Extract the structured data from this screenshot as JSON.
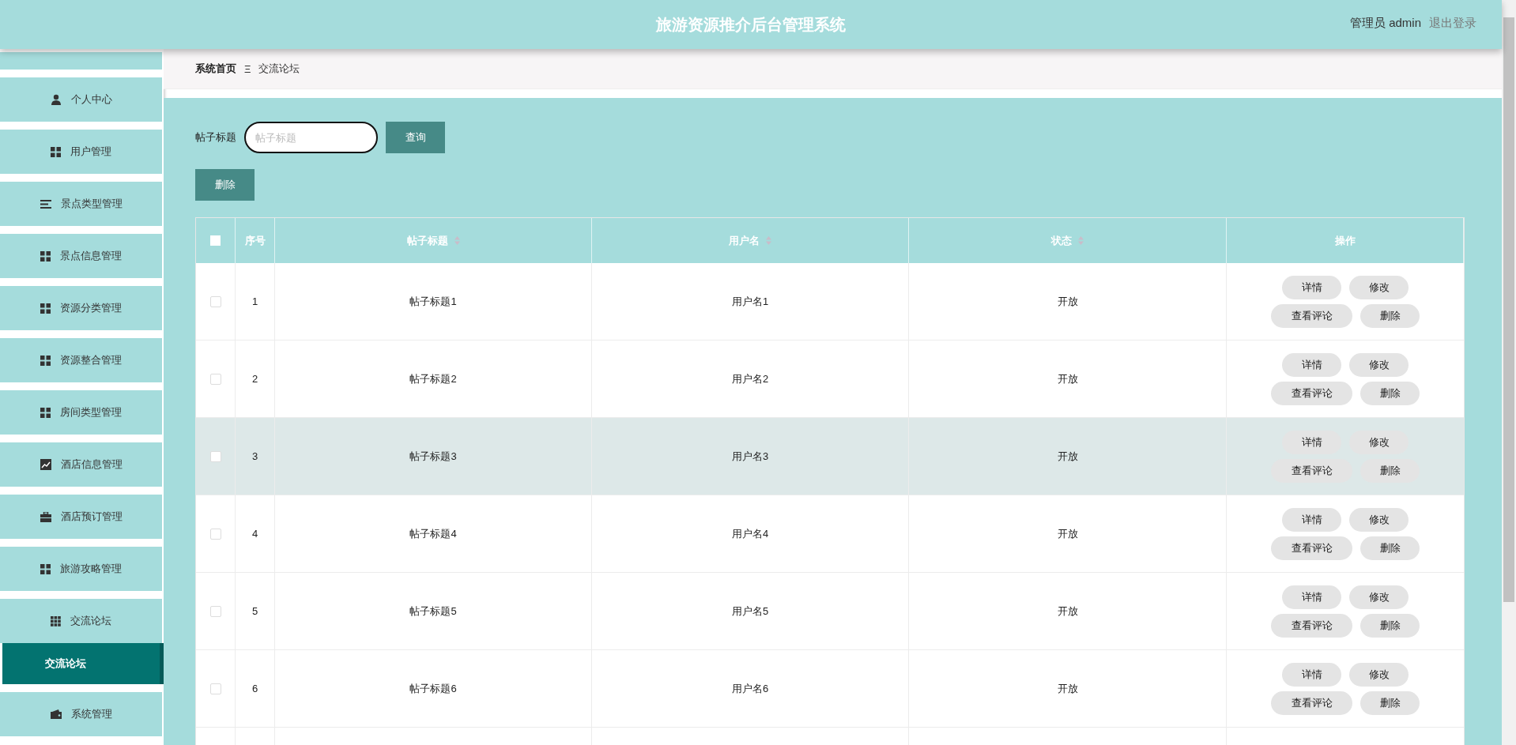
{
  "header": {
    "title": "旅游资源推介后台管理系统",
    "user": "管理员 admin",
    "logout": "退出登录"
  },
  "sidebar": {
    "items": [
      {
        "label": "个人中心"
      },
      {
        "label": "用户管理"
      },
      {
        "label": "景点类型管理"
      },
      {
        "label": "景点信息管理"
      },
      {
        "label": "资源分类管理"
      },
      {
        "label": "资源整合管理"
      },
      {
        "label": "房间类型管理"
      },
      {
        "label": "酒店信息管理"
      },
      {
        "label": "酒店预订管理"
      },
      {
        "label": "旅游攻略管理"
      },
      {
        "label": "交流论坛",
        "children": [
          {
            "label": "交流论坛",
            "selected": true
          }
        ]
      },
      {
        "label": "系统管理"
      }
    ]
  },
  "breadcrumb": {
    "home": "系统首页",
    "separator": "Ξ",
    "current": "交流论坛"
  },
  "search": {
    "label": "帖子标题",
    "placeholder": "帖子标题",
    "button": "查询"
  },
  "delete_button": "删除",
  "table": {
    "select_all_checked": false,
    "columns": [
      {
        "label": "序号",
        "sortable": false
      },
      {
        "label": "帖子标题",
        "sortable": true
      },
      {
        "label": "用户名",
        "sortable": true
      },
      {
        "label": "状态",
        "sortable": true
      },
      {
        "label": "操作",
        "sortable": false
      }
    ],
    "rows": [
      {
        "index": "1",
        "title": "帖子标题1",
        "user": "用户名1",
        "status": "开放",
        "highlighted": false,
        "checked": false,
        "actions": [
          "详情",
          "修改",
          "查看评论",
          "删除"
        ]
      },
      {
        "index": "2",
        "title": "帖子标题2",
        "user": "用户名2",
        "status": "开放",
        "highlighted": false,
        "checked": false,
        "actions": [
          "详情",
          "修改",
          "查看评论",
          "删除"
        ]
      },
      {
        "index": "3",
        "title": "帖子标题3",
        "user": "用户名3",
        "status": "开放",
        "highlighted": true,
        "checked": false,
        "actions": [
          "详情",
          "修改",
          "查看评论",
          "删除"
        ]
      },
      {
        "index": "4",
        "title": "帖子标题4",
        "user": "用户名4",
        "status": "开放",
        "highlighted": false,
        "checked": false,
        "actions": [
          "详情",
          "修改",
          "查看评论",
          "删除"
        ]
      },
      {
        "index": "5",
        "title": "帖子标题5",
        "user": "用户名5",
        "status": "开放",
        "highlighted": false,
        "checked": false,
        "actions": [
          "详情",
          "修改",
          "查看评论",
          "删除"
        ]
      },
      {
        "index": "6",
        "title": "帖子标题6",
        "user": "用户名6",
        "status": "开放",
        "highlighted": false,
        "checked": false,
        "actions": [
          "详情",
          "修改",
          "查看评论",
          "删除"
        ]
      }
    ]
  }
}
